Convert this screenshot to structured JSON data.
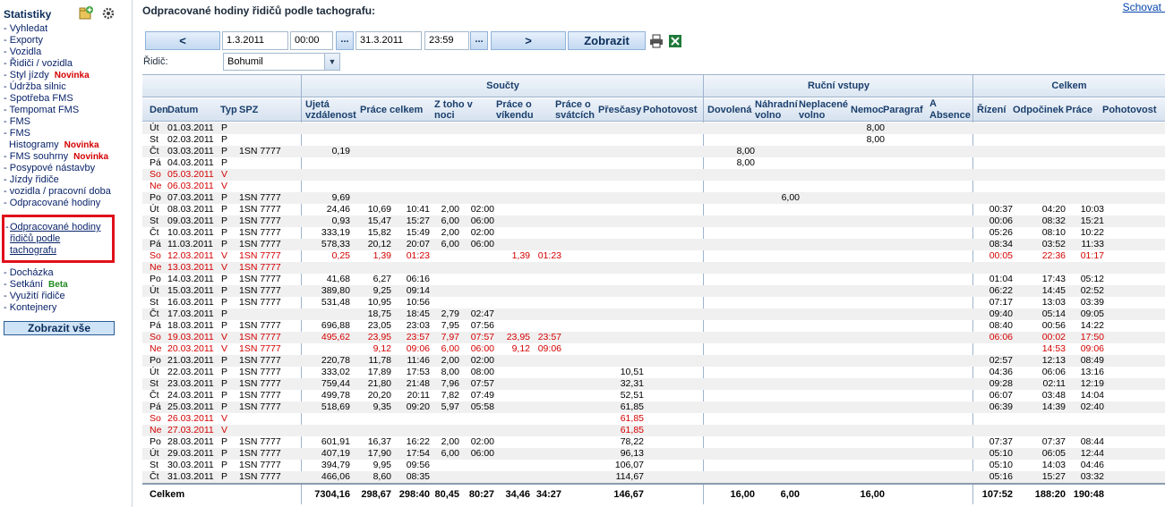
{
  "sidebar": {
    "title": "Statistiky",
    "items": [
      {
        "label": "Vyhledat",
        "badge": ""
      },
      {
        "label": "Exporty",
        "badge": ""
      },
      {
        "label": "Vozidla",
        "badge": ""
      },
      {
        "label": "Řidiči / vozidla",
        "badge": ""
      },
      {
        "label": "Styl jízdy",
        "badge": "Novinka",
        "badge_color": "red"
      },
      {
        "label": "Údržba silnic",
        "badge": ""
      },
      {
        "label": "Spotřeba FMS",
        "badge": ""
      },
      {
        "label": "Tempomat FMS",
        "badge": ""
      },
      {
        "label": "FMS",
        "badge": ""
      },
      {
        "label": "FMS",
        "badge": ""
      },
      {
        "label": "Histogramy",
        "badge": "Novinka",
        "badge_color": "red",
        "indent": true
      },
      {
        "label": "FMS souhrny",
        "badge": "Novinka",
        "badge_color": "red"
      },
      {
        "label": "Posypové nástavby",
        "badge": ""
      },
      {
        "label": "Jízdy řidiče",
        "badge": ""
      },
      {
        "label": "vozidla / pracovní doba",
        "badge": ""
      },
      {
        "label": "Odpracované hodiny",
        "badge": ""
      }
    ],
    "selected": "Odpracované hodiny řidičů podle tachografu",
    "items_after": [
      {
        "label": "Docházka",
        "badge": ""
      },
      {
        "label": "Setkání",
        "badge": "Beta",
        "badge_color": "green"
      },
      {
        "label": "Využití řidiče",
        "badge": ""
      },
      {
        "label": "Kontejnery",
        "badge": ""
      }
    ],
    "show_all": "Zobrazit vše"
  },
  "header": {
    "title": "Odpracované hodiny řidičů podle tachografu:",
    "hide_link": "Schovat a"
  },
  "filters": {
    "prev": "<",
    "date_from": "1.3.2011",
    "time_from": "00:00",
    "date_to": "31.3.2011",
    "time_to": "23:59",
    "next": ">",
    "show": "Zobrazit",
    "dots": "...",
    "driver_label": "Řidič:",
    "driver_value": "Bohumil"
  },
  "table": {
    "groups": [
      "Součty",
      "Ruční vstupy",
      "Celkem"
    ],
    "columns": {
      "den": "Den",
      "datum": "Datum",
      "typ": "Typ",
      "spz": "SPZ",
      "ujeta": "Ujetá vzdálenost",
      "prace": "Práce celkem",
      "noc": "Z toho v noci",
      "vikend": "Práce o víkendu",
      "svatky": "Práce o svátcích",
      "prescasy": "Přesčasy",
      "pohotovost": "Pohotovost",
      "dovolena": "Dovolená",
      "nahradni": "Náhradní volno",
      "neplacene": "Neplacené volno",
      "nemoc": "Nemoc",
      "paragraf": "Paragraf",
      "absence": "Absence",
      "a": "A",
      "rizeni": "Řízení",
      "odpocinek": "Odpočinek",
      "prace2": "Práce",
      "pohotovost2": "Pohotovost"
    },
    "rows": [
      {
        "den": "Út",
        "datum": "01.03.2011",
        "typ": "P",
        "spz": "",
        "km": "",
        "pc": "",
        "pch": "",
        "zn": "",
        "znh": "",
        "pv": "",
        "pvh": "",
        "ps": "",
        "psh": "",
        "ot": "",
        "dov": "",
        "nv": "",
        "par": "8,00",
        "ri": "",
        "od": "",
        "pr": "",
        "we": false
      },
      {
        "den": "St",
        "datum": "02.03.2011",
        "typ": "P",
        "spz": "",
        "km": "",
        "pc": "",
        "pch": "",
        "zn": "",
        "znh": "",
        "pv": "",
        "pvh": "",
        "ps": "",
        "psh": "",
        "ot": "",
        "dov": "",
        "nv": "",
        "par": "8,00",
        "ri": "",
        "od": "",
        "pr": "",
        "we": false
      },
      {
        "den": "Čt",
        "datum": "03.03.2011",
        "typ": "P",
        "spz": "1SN 7777",
        "km": "0,19",
        "pc": "",
        "pch": "",
        "zn": "",
        "znh": "",
        "pv": "",
        "pvh": "",
        "ps": "",
        "psh": "",
        "ot": "",
        "dov": "8,00",
        "nv": "",
        "par": "",
        "ri": "",
        "od": "",
        "pr": "",
        "we": false
      },
      {
        "den": "Pá",
        "datum": "04.03.2011",
        "typ": "P",
        "spz": "",
        "km": "",
        "pc": "",
        "pch": "",
        "zn": "",
        "znh": "",
        "pv": "",
        "pvh": "",
        "ps": "",
        "psh": "",
        "ot": "",
        "dov": "8,00",
        "nv": "",
        "par": "",
        "ri": "",
        "od": "",
        "pr": "",
        "we": false
      },
      {
        "den": "So",
        "datum": "05.03.2011",
        "typ": "V",
        "spz": "",
        "km": "",
        "pc": "",
        "pch": "",
        "zn": "",
        "znh": "",
        "pv": "",
        "pvh": "",
        "ps": "",
        "psh": "",
        "ot": "",
        "dov": "",
        "nv": "",
        "par": "",
        "ri": "",
        "od": "",
        "pr": "",
        "we": true
      },
      {
        "den": "Ne",
        "datum": "06.03.2011",
        "typ": "V",
        "spz": "",
        "km": "",
        "pc": "",
        "pch": "",
        "zn": "",
        "znh": "",
        "pv": "",
        "pvh": "",
        "ps": "",
        "psh": "",
        "ot": "",
        "dov": "",
        "nv": "",
        "par": "",
        "ri": "",
        "od": "",
        "pr": "",
        "we": true
      },
      {
        "den": "Po",
        "datum": "07.03.2011",
        "typ": "P",
        "spz": "1SN 7777",
        "km": "9,69",
        "pc": "",
        "pch": "",
        "zn": "",
        "znh": "",
        "pv": "",
        "pvh": "",
        "ps": "",
        "psh": "",
        "ot": "",
        "dov": "",
        "nv": "6,00",
        "par": "",
        "ri": "",
        "od": "",
        "pr": "",
        "we": false
      },
      {
        "den": "Út",
        "datum": "08.03.2011",
        "typ": "P",
        "spz": "1SN 7777",
        "km": "24,46",
        "pc": "10,69",
        "pch": "10:41",
        "zn": "2,00",
        "znh": "02:00",
        "pv": "",
        "pvh": "",
        "ps": "",
        "psh": "",
        "ot": "",
        "dov": "",
        "nv": "",
        "par": "",
        "ri": "00:37",
        "od": "04:20",
        "pr": "10:03",
        "we": false
      },
      {
        "den": "St",
        "datum": "09.03.2011",
        "typ": "P",
        "spz": "1SN 7777",
        "km": "0,93",
        "pc": "15,47",
        "pch": "15:27",
        "zn": "6,00",
        "znh": "06:00",
        "pv": "",
        "pvh": "",
        "ps": "",
        "psh": "",
        "ot": "",
        "dov": "",
        "nv": "",
        "par": "",
        "ri": "00:06",
        "od": "08:32",
        "pr": "15:21",
        "we": false
      },
      {
        "den": "Čt",
        "datum": "10.03.2011",
        "typ": "P",
        "spz": "1SN 7777",
        "km": "333,19",
        "pc": "15,82",
        "pch": "15:49",
        "zn": "2,00",
        "znh": "02:00",
        "pv": "",
        "pvh": "",
        "ps": "",
        "psh": "",
        "ot": "",
        "dov": "",
        "nv": "",
        "par": "",
        "ri": "05:26",
        "od": "08:10",
        "pr": "10:22",
        "we": false
      },
      {
        "den": "Pá",
        "datum": "11.03.2011",
        "typ": "P",
        "spz": "1SN 7777",
        "km": "578,33",
        "pc": "20,12",
        "pch": "20:07",
        "zn": "6,00",
        "znh": "06:00",
        "pv": "",
        "pvh": "",
        "ps": "",
        "psh": "",
        "ot": "",
        "dov": "",
        "nv": "",
        "par": "",
        "ri": "08:34",
        "od": "03:52",
        "pr": "11:33",
        "we": false
      },
      {
        "den": "So",
        "datum": "12.03.2011",
        "typ": "V",
        "spz": "1SN 7777",
        "km": "0,25",
        "pc": "1,39",
        "pch": "01:23",
        "zn": "",
        "znh": "",
        "pv": "1,39",
        "pvh": "01:23",
        "ps": "",
        "psh": "",
        "ot": "",
        "dov": "",
        "nv": "",
        "par": "",
        "ri": "00:05",
        "od": "22:36",
        "pr": "01:17",
        "we": true
      },
      {
        "den": "Ne",
        "datum": "13.03.2011",
        "typ": "V",
        "spz": "1SN 7777",
        "km": "",
        "pc": "",
        "pch": "",
        "zn": "",
        "znh": "",
        "pv": "",
        "pvh": "",
        "ps": "",
        "psh": "",
        "ot": "",
        "dov": "",
        "nv": "",
        "par": "",
        "ri": "",
        "od": "",
        "pr": "",
        "we": true
      },
      {
        "den": "Po",
        "datum": "14.03.2011",
        "typ": "P",
        "spz": "1SN 7777",
        "km": "41,68",
        "pc": "6,27",
        "pch": "06:16",
        "zn": "",
        "znh": "",
        "pv": "",
        "pvh": "",
        "ps": "",
        "psh": "",
        "ot": "",
        "dov": "",
        "nv": "",
        "par": "",
        "ri": "01:04",
        "od": "17:43",
        "pr": "05:12",
        "we": false
      },
      {
        "den": "Út",
        "datum": "15.03.2011",
        "typ": "P",
        "spz": "1SN 7777",
        "km": "389,80",
        "pc": "9,25",
        "pch": "09:14",
        "zn": "",
        "znh": "",
        "pv": "",
        "pvh": "",
        "ps": "",
        "psh": "",
        "ot": "",
        "dov": "",
        "nv": "",
        "par": "",
        "ri": "06:22",
        "od": "14:45",
        "pr": "02:52",
        "we": false
      },
      {
        "den": "St",
        "datum": "16.03.2011",
        "typ": "P",
        "spz": "1SN 7777",
        "km": "531,48",
        "pc": "10,95",
        "pch": "10:56",
        "zn": "",
        "znh": "",
        "pv": "",
        "pvh": "",
        "ps": "",
        "psh": "",
        "ot": "",
        "dov": "",
        "nv": "",
        "par": "",
        "ri": "07:17",
        "od": "13:03",
        "pr": "03:39",
        "we": false
      },
      {
        "den": "Čt",
        "datum": "17.03.2011",
        "typ": "P",
        "spz": "",
        "km": "",
        "pc": "18,75",
        "pch": "18:45",
        "zn": "2,79",
        "znh": "02:47",
        "pv": "",
        "pvh": "",
        "ps": "",
        "psh": "",
        "ot": "",
        "dov": "",
        "nv": "",
        "par": "",
        "ri": "09:40",
        "od": "05:14",
        "pr": "09:05",
        "we": false
      },
      {
        "den": "Pá",
        "datum": "18.03.2011",
        "typ": "P",
        "spz": "1SN 7777",
        "km": "696,88",
        "pc": "23,05",
        "pch": "23:03",
        "zn": "7,95",
        "znh": "07:56",
        "pv": "",
        "pvh": "",
        "ps": "",
        "psh": "",
        "ot": "",
        "dov": "",
        "nv": "",
        "par": "",
        "ri": "08:40",
        "od": "00:56",
        "pr": "14:22",
        "we": false
      },
      {
        "den": "So",
        "datum": "19.03.2011",
        "typ": "V",
        "spz": "1SN 7777",
        "km": "495,62",
        "pc": "23,95",
        "pch": "23:57",
        "zn": "7,97",
        "znh": "07:57",
        "pv": "23,95",
        "pvh": "23:57",
        "ps": "",
        "psh": "",
        "ot": "",
        "dov": "",
        "nv": "",
        "par": "",
        "ri": "06:06",
        "od": "00:02",
        "pr": "17:50",
        "we": true
      },
      {
        "den": "Ne",
        "datum": "20.03.2011",
        "typ": "V",
        "spz": "1SN 7777",
        "km": "",
        "pc": "9,12",
        "pch": "09:06",
        "zn": "6,00",
        "znh": "06:00",
        "pv": "9,12",
        "pvh": "09:06",
        "ps": "",
        "psh": "",
        "ot": "",
        "dov": "",
        "nv": "",
        "par": "",
        "ri": "",
        "od": "14:53",
        "pr": "09:06",
        "we": true
      },
      {
        "den": "Po",
        "datum": "21.03.2011",
        "typ": "P",
        "spz": "1SN 7777",
        "km": "220,78",
        "pc": "11,78",
        "pch": "11:46",
        "zn": "2,00",
        "znh": "02:00",
        "pv": "",
        "pvh": "",
        "ps": "",
        "psh": "",
        "ot": "",
        "dov": "",
        "nv": "",
        "par": "",
        "ri": "02:57",
        "od": "12:13",
        "pr": "08:49",
        "we": false
      },
      {
        "den": "Út",
        "datum": "22.03.2011",
        "typ": "P",
        "spz": "1SN 7777",
        "km": "333,02",
        "pc": "17,89",
        "pch": "17:53",
        "zn": "8,00",
        "znh": "08:00",
        "pv": "",
        "pvh": "",
        "ps": "",
        "psh": "",
        "ot": "10,51",
        "dov": "",
        "nv": "",
        "par": "",
        "ri": "04:36",
        "od": "06:06",
        "pr": "13:16",
        "we": false
      },
      {
        "den": "St",
        "datum": "23.03.2011",
        "typ": "P",
        "spz": "1SN 7777",
        "km": "759,44",
        "pc": "21,80",
        "pch": "21:48",
        "zn": "7,96",
        "znh": "07:57",
        "pv": "",
        "pvh": "",
        "ps": "",
        "psh": "",
        "ot": "32,31",
        "dov": "",
        "nv": "",
        "par": "",
        "ri": "09:28",
        "od": "02:11",
        "pr": "12:19",
        "we": false
      },
      {
        "den": "Čt",
        "datum": "24.03.2011",
        "typ": "P",
        "spz": "1SN 7777",
        "km": "499,78",
        "pc": "20,20",
        "pch": "20:11",
        "zn": "7,82",
        "znh": "07:49",
        "pv": "",
        "pvh": "",
        "ps": "",
        "psh": "",
        "ot": "52,51",
        "dov": "",
        "nv": "",
        "par": "",
        "ri": "06:07",
        "od": "03:48",
        "pr": "14:04",
        "we": false
      },
      {
        "den": "Pá",
        "datum": "25.03.2011",
        "typ": "P",
        "spz": "1SN 7777",
        "km": "518,69",
        "pc": "9,35",
        "pch": "09:20",
        "zn": "5,97",
        "znh": "05:58",
        "pv": "",
        "pvh": "",
        "ps": "",
        "psh": "",
        "ot": "61,85",
        "dov": "",
        "nv": "",
        "par": "",
        "ri": "06:39",
        "od": "14:39",
        "pr": "02:40",
        "we": false
      },
      {
        "den": "So",
        "datum": "26.03.2011",
        "typ": "V",
        "spz": "",
        "km": "",
        "pc": "",
        "pch": "",
        "zn": "",
        "znh": "",
        "pv": "",
        "pvh": "",
        "ps": "",
        "psh": "",
        "ot": "61,85",
        "dov": "",
        "nv": "",
        "par": "",
        "ri": "",
        "od": "",
        "pr": "",
        "we": true
      },
      {
        "den": "Ne",
        "datum": "27.03.2011",
        "typ": "V",
        "spz": "",
        "km": "",
        "pc": "",
        "pch": "",
        "zn": "",
        "znh": "",
        "pv": "",
        "pvh": "",
        "ps": "",
        "psh": "",
        "ot": "61,85",
        "dov": "",
        "nv": "",
        "par": "",
        "ri": "",
        "od": "",
        "pr": "",
        "we": true
      },
      {
        "den": "Po",
        "datum": "28.03.2011",
        "typ": "P",
        "spz": "1SN 7777",
        "km": "601,91",
        "pc": "16,37",
        "pch": "16:22",
        "zn": "2,00",
        "znh": "02:00",
        "pv": "",
        "pvh": "",
        "ps": "",
        "psh": "",
        "ot": "78,22",
        "dov": "",
        "nv": "",
        "par": "",
        "ri": "07:37",
        "od": "07:37",
        "pr": "08:44",
        "we": false
      },
      {
        "den": "Út",
        "datum": "29.03.2011",
        "typ": "P",
        "spz": "1SN 7777",
        "km": "407,19",
        "pc": "17,90",
        "pch": "17:54",
        "zn": "6,00",
        "znh": "06:00",
        "pv": "",
        "pvh": "",
        "ps": "",
        "psh": "",
        "ot": "96,13",
        "dov": "",
        "nv": "",
        "par": "",
        "ri": "05:10",
        "od": "06:05",
        "pr": "12:44",
        "we": false
      },
      {
        "den": "St",
        "datum": "30.03.2011",
        "typ": "P",
        "spz": "1SN 7777",
        "km": "394,79",
        "pc": "9,95",
        "pch": "09:56",
        "zn": "",
        "znh": "",
        "pv": "",
        "pvh": "",
        "ps": "",
        "psh": "",
        "ot": "106,07",
        "dov": "",
        "nv": "",
        "par": "",
        "ri": "05:10",
        "od": "14:03",
        "pr": "04:46",
        "we": false
      },
      {
        "den": "Čt",
        "datum": "31.03.2011",
        "typ": "P",
        "spz": "1SN 7777",
        "km": "466,06",
        "pc": "8,60",
        "pch": "08:35",
        "zn": "",
        "znh": "",
        "pv": "",
        "pvh": "",
        "ps": "",
        "psh": "",
        "ot": "114,67",
        "dov": "",
        "nv": "",
        "par": "",
        "ri": "05:16",
        "od": "15:27",
        "pr": "03:32",
        "we": false
      }
    ],
    "totals": {
      "label": "Celkem",
      "km": "7304,16",
      "pc": "298,67",
      "pch": "298:40",
      "zn": "80,45",
      "znh": "80:27",
      "pv": "34,46",
      "pvh": "34:27",
      "ot": "146,67",
      "dov": "16,00",
      "nv": "6,00",
      "par": "16,00",
      "ri": "107:52",
      "od": "188:20",
      "pr": "190:48"
    }
  }
}
